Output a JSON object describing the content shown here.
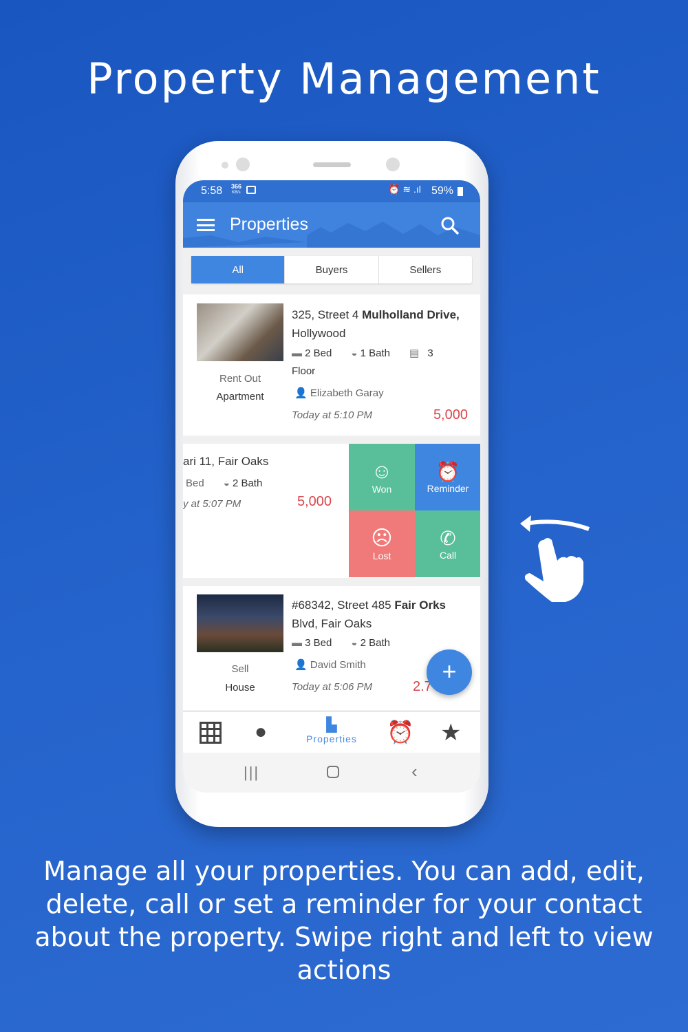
{
  "headline": "Property Management",
  "description": "Manage all your properties. You can add, edit, delete, call or set a reminder for your contact about the property. Swipe right and left to view actions",
  "status_bar": {
    "time": "5:58",
    "speed": "366",
    "speed_unit": "KB/s",
    "battery": "59%"
  },
  "app_bar": {
    "title": "Properties",
    "menu_icon": "hamburger-icon",
    "search_icon": "search-icon"
  },
  "tabs": [
    {
      "label": "All",
      "active": true
    },
    {
      "label": "Buyers"
    },
    {
      "label": "Sellers"
    }
  ],
  "listings": [
    {
      "address_light": "325, Street 4 ",
      "address_bold": "Mulholland Drive,",
      "address_line2": "Hollywood",
      "beds": "2 Bed",
      "baths": "1 Bath",
      "floors": "3",
      "floor_label": "Floor",
      "contact": "Elizabeth Garay",
      "time": "Today at 5:10 PM",
      "price": "5,000",
      "type": "Rent Out",
      "category": "Apartment"
    },
    {
      "address": "ari 11, Fair Oaks",
      "beds": "Bed",
      "baths": "2 Bath",
      "time": "y at 5:07 PM",
      "price": "5,000"
    },
    {
      "address_light": "#68342, Street 485 ",
      "address_bold": "Fair Orks",
      "address_line2": "Blvd, Fair Oaks",
      "beds": "3 Bed",
      "baths": "2 Bath",
      "contact": "David Smith",
      "time": "Today at 5:06 PM",
      "price": "2.7",
      "type": "Sell",
      "category": "House"
    }
  ],
  "swipe_actions": [
    {
      "label": "Won",
      "icon": "smile-icon",
      "color": "#58bf9a"
    },
    {
      "label": "Reminder",
      "icon": "alarm-icon",
      "color": "#3f86e0"
    },
    {
      "label": "Lost",
      "icon": "sad-icon",
      "color": "#f07a7a"
    },
    {
      "label": "Call",
      "icon": "phone-icon",
      "color": "#58bf9a"
    }
  ],
  "bottom_nav": [
    {
      "icon": "grid-icon"
    },
    {
      "icon": "person-icon"
    },
    {
      "icon": "building-icon",
      "label": "Properties",
      "active": true
    },
    {
      "icon": "alarm-icon"
    },
    {
      "icon": "star-icon"
    }
  ],
  "accent": "#3f86e0"
}
